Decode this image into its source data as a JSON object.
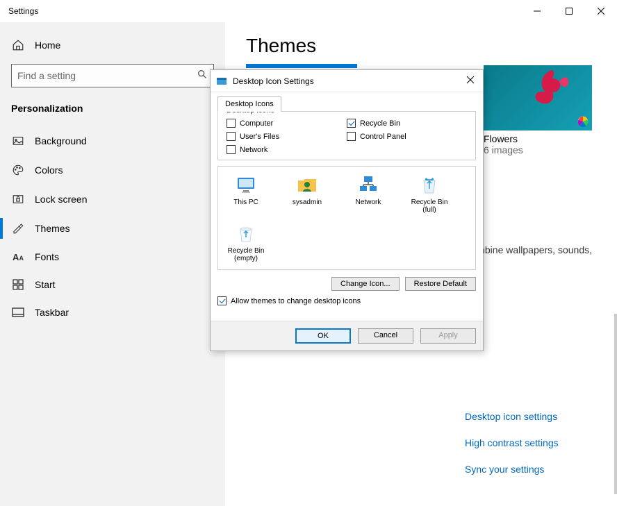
{
  "window": {
    "title": "Settings"
  },
  "sidebar": {
    "home": "Home",
    "search_placeholder": "Find a setting",
    "category": "Personalization",
    "items": [
      {
        "label": "Background"
      },
      {
        "label": "Colors"
      },
      {
        "label": "Lock screen"
      },
      {
        "label": "Themes"
      },
      {
        "label": "Fonts"
      },
      {
        "label": "Start"
      },
      {
        "label": "Taskbar"
      }
    ]
  },
  "page": {
    "title": "Themes",
    "theme_name": "Flowers",
    "theme_count": "6 images",
    "description_tail": "nbine wallpapers, sounds,",
    "links": [
      "Desktop icon settings",
      "High contrast settings",
      "Sync your settings"
    ]
  },
  "dialog": {
    "title": "Desktop Icon Settings",
    "tab": "Desktop Icons",
    "group": "Desktop icons",
    "checkboxes": {
      "computer": {
        "label": "Computer",
        "checked": false
      },
      "recycle": {
        "label": "Recycle Bin",
        "checked": true
      },
      "users": {
        "label": "User's Files",
        "checked": false
      },
      "control": {
        "label": "Control Panel",
        "checked": false
      },
      "network": {
        "label": "Network",
        "checked": false
      }
    },
    "icons": [
      "This PC",
      "sysadmin",
      "Network",
      "Recycle Bin (full)",
      "Recycle Bin (empty)"
    ],
    "buttons": {
      "change": "Change Icon...",
      "restore": "Restore Default",
      "ok": "OK",
      "cancel": "Cancel",
      "apply": "Apply"
    },
    "allow": "Allow themes to change desktop icons"
  }
}
